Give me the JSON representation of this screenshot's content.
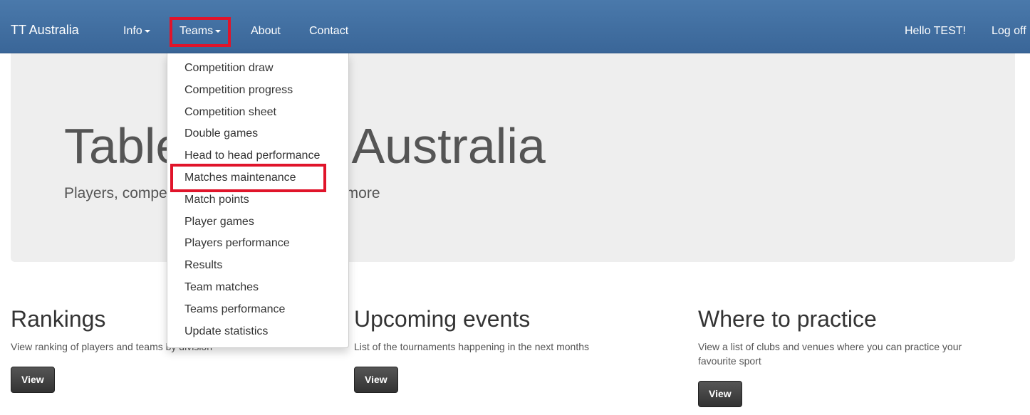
{
  "navbar": {
    "brand": "TT Australia",
    "items": [
      {
        "label": "Info",
        "dropdown": true
      },
      {
        "label": "Teams",
        "dropdown": true,
        "active": true
      },
      {
        "label": "About"
      },
      {
        "label": "Contact"
      }
    ],
    "greeting": "Hello TEST!",
    "logoff": "Log off"
  },
  "teams_menu": {
    "items": [
      "Competition draw",
      "Competition progress",
      "Competition sheet",
      "Double games",
      "Head to head performance",
      "Matches maintenance",
      "Match points",
      "Player games",
      "Players performance",
      "Results",
      "Team matches",
      "Teams performance",
      "Update statistics"
    ],
    "highlighted": "Matches maintenance"
  },
  "jumbotron": {
    "title": "Table Tennis Australia",
    "subtitle": "Players, competitions, statistics and much more"
  },
  "sections": [
    {
      "heading": "Rankings",
      "text": "View ranking of players and teams by division",
      "button": "View"
    },
    {
      "heading": "Upcoming events",
      "text": "List of the tournaments happening in the next months",
      "button": "View"
    },
    {
      "heading": "Where to practice",
      "text": "View a list of clubs and venues where you can practice your favourite sport",
      "button": "View"
    }
  ],
  "colors": {
    "navbar": "#3f6ea0",
    "highlight": "#e0142a",
    "jumbotron": "#eeeeee"
  }
}
